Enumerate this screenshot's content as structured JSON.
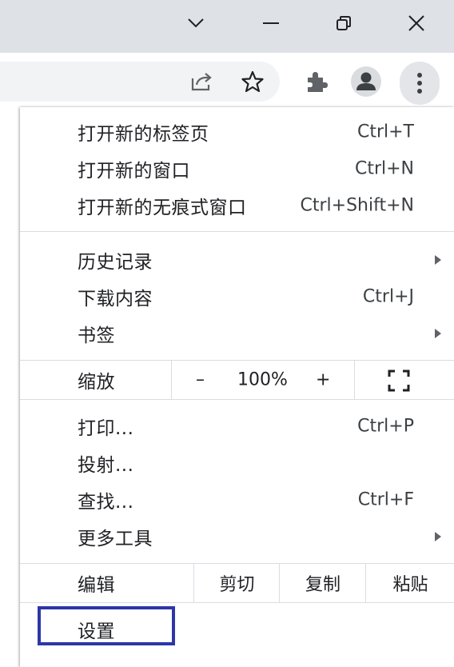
{
  "window_controls": {
    "tab_search": "chevron-down-icon",
    "minimize": "minimize-icon",
    "restore": "restore-icon",
    "close": "close-icon"
  },
  "toolbar": {
    "share_icon": "share-icon",
    "bookmark_icon": "star-icon",
    "extensions_icon": "puzzle-icon",
    "profile_icon": "avatar-icon",
    "menu_icon": "kebab-menu-icon"
  },
  "menu": {
    "group1": [
      {
        "label": "打开新的标签页",
        "shortcut": "Ctrl+T"
      },
      {
        "label": "打开新的窗口",
        "shortcut": "Ctrl+N"
      },
      {
        "label": "打开新的无痕式窗口",
        "shortcut": "Ctrl+Shift+N"
      }
    ],
    "group2": [
      {
        "label": "历史记录",
        "shortcut": ""
      },
      {
        "label": "下载内容",
        "shortcut": "Ctrl+J"
      },
      {
        "label": "书签",
        "shortcut": ""
      }
    ],
    "zoom": {
      "label": "缩放",
      "minus": "–",
      "value": "100%",
      "plus": "+"
    },
    "group3": [
      {
        "label": "打印...",
        "shortcut": "Ctrl+P"
      },
      {
        "label": "投射...",
        "shortcut": ""
      },
      {
        "label": "查找...",
        "shortcut": "Ctrl+F"
      },
      {
        "label": "更多工具",
        "shortcut": ""
      }
    ],
    "edit": {
      "label": "编辑",
      "cut": "剪切",
      "copy": "复制",
      "paste": "粘贴"
    },
    "settings": {
      "label": "设置"
    }
  },
  "colors": {
    "titlebar": "#dee1e6",
    "highlight": "#2e36a8"
  }
}
